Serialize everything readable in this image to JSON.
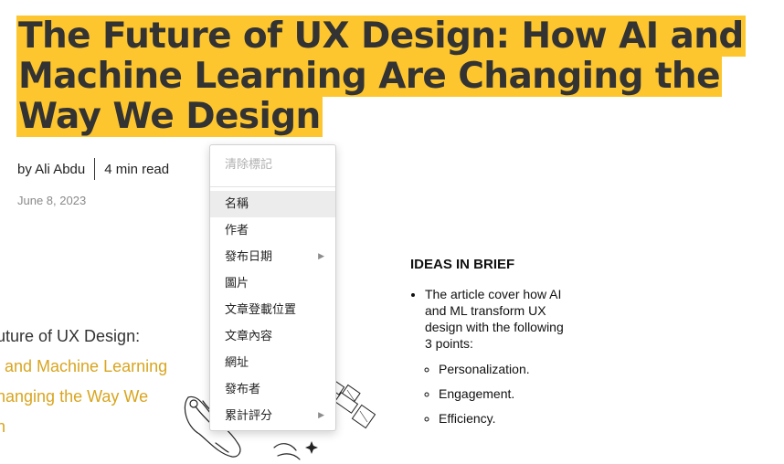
{
  "article": {
    "title": "The Future of UX Design: How AI and Machine Learning Are Changing the Way We Design",
    "author": "by Ali Abdu",
    "read_time": "4 min read",
    "date": "June 8, 2023"
  },
  "hero": {
    "line1": "uture of UX Design:",
    "line2": "l and Machine Learning",
    "line3": "nanging the Way We",
    "line4": "n"
  },
  "ideas": {
    "title": "IDEAS IN BRIEF",
    "intro": "The article cover how AI and ML transform UX design with the following 3 points:",
    "points": [
      "Personalization.",
      "Engagement.",
      "Efficiency."
    ]
  },
  "context_menu": {
    "clear": "清除標記",
    "items": [
      {
        "label": "名稱"
      },
      {
        "label": "作者"
      },
      {
        "label": "發布日期",
        "arrow": "▶"
      },
      {
        "label": "圖片"
      },
      {
        "label": "文章登載位置"
      },
      {
        "label": "文章內容"
      },
      {
        "label": "網址"
      },
      {
        "label": "發布者"
      },
      {
        "label": "累計評分",
        "arrow": "▶"
      }
    ]
  },
  "colors": {
    "highlight": "#fdc62f",
    "hero_gold": "#d9a520"
  }
}
